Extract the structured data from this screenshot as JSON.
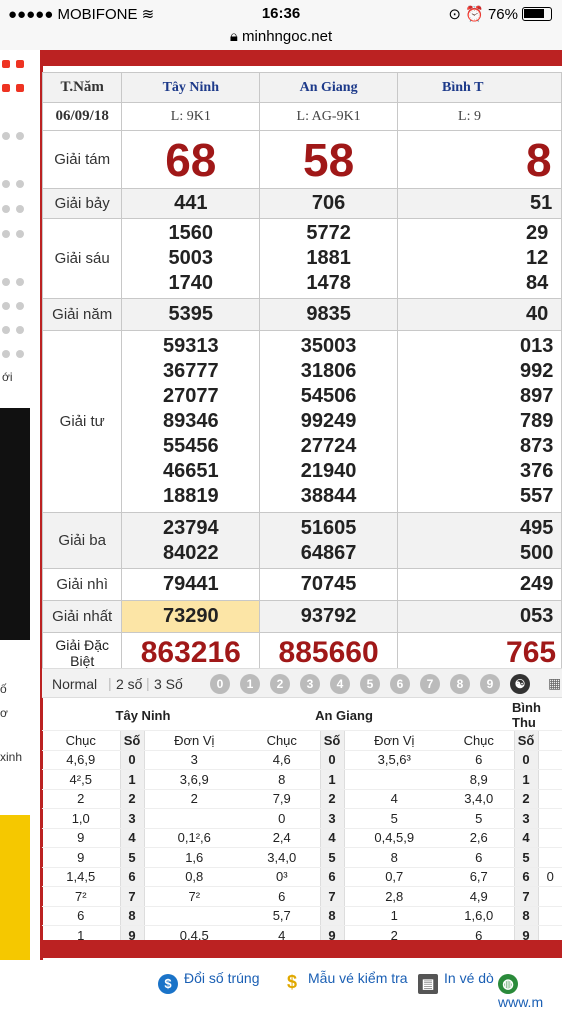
{
  "status": {
    "carrier": "MOBIFONE",
    "time": "16:36",
    "battery": "76%"
  },
  "browser": {
    "url": "minhngoc.net"
  },
  "sidebar": {
    "texts": [
      "ới",
      "ố",
      "ơ",
      "xinh"
    ]
  },
  "results": {
    "label_header": "T.Năm",
    "label_date": "06/09/18",
    "provinces": [
      {
        "name": "Tây Ninh",
        "code": "L: 9K1",
        "g8": "68",
        "g7": "441",
        "g6": [
          "1560",
          "5003",
          "1740"
        ],
        "g5": "5395",
        "g4": [
          "59313",
          "36777",
          "27077",
          "89346",
          "55456",
          "46651",
          "18819"
        ],
        "g3": [
          "23794",
          "84022"
        ],
        "g2": "79441",
        "g1": "73290",
        "gdb": "863216"
      },
      {
        "name": "An Giang",
        "code": "L: AG-9K1",
        "g8": "58",
        "g7": "706",
        "g6": [
          "5772",
          "1881",
          "1478"
        ],
        "g5": "9835",
        "g4": [
          "35003",
          "31806",
          "54506",
          "99249",
          "27724",
          "21940",
          "38844"
        ],
        "g3": [
          "51605",
          "64867"
        ],
        "g2": "70745",
        "g1": "93792",
        "gdb": "885660"
      },
      {
        "name": "Bình T",
        "code": "L: 9",
        "g8": "8",
        "g7": "51",
        "g6": [
          "29",
          "12",
          "84"
        ],
        "g5": "40",
        "g4": [
          "013",
          "992",
          "897",
          "789",
          "873",
          "376",
          "557"
        ],
        "g3": [
          "495",
          "500"
        ],
        "g2": "249",
        "g1": "053",
        "gdb": "765"
      }
    ],
    "labels": {
      "g8": "Giải tám",
      "g7": "Giải bảy",
      "g6": "Giải sáu",
      "g5": "Giải năm",
      "g4": "Giải tư",
      "g3": "Giải ba",
      "g2": "Giải nhì",
      "g1": "Giải nhất",
      "gdb": "Giải Đặc Biệt"
    }
  },
  "filter": {
    "tabs": [
      "Normal",
      "2 số",
      "3 Số"
    ],
    "digits": [
      "0",
      "1",
      "2",
      "3",
      "4",
      "5",
      "6",
      "7",
      "8",
      "9"
    ]
  },
  "loto": {
    "headers": [
      "Tây Ninh",
      "An Giang",
      "Bình Thu"
    ],
    "subheaders": {
      "chuc": "Chục",
      "so": "Số",
      "donvi": "Đơn Vị"
    },
    "rows": [
      {
        "so": "0",
        "tn": [
          "4,6,9",
          "3"
        ],
        "ag": [
          "4,6",
          "3,5,6³"
        ],
        "bt": [
          "6",
          ""
        ]
      },
      {
        "so": "1",
        "tn": [
          "4²,5",
          "3,6,9"
        ],
        "ag": [
          "8",
          ""
        ],
        "bt": [
          "8,9",
          ""
        ]
      },
      {
        "so": "2",
        "tn": [
          "2",
          "2"
        ],
        "ag": [
          "7,9",
          "4"
        ],
        "bt": [
          "3,4,0",
          ""
        ]
      },
      {
        "so": "3",
        "tn": [
          "1,0",
          ""
        ],
        "ag": [
          "0",
          "5"
        ],
        "bt": [
          "5",
          ""
        ]
      },
      {
        "so": "4",
        "tn": [
          "9",
          "0,1²,6"
        ],
        "ag": [
          "2,4",
          "0,4,5,9"
        ],
        "bt": [
          "2,6",
          ""
        ]
      },
      {
        "so": "5",
        "tn": [
          "9",
          "1,6"
        ],
        "ag": [
          "3,4,0",
          "8"
        ],
        "bt": [
          "6",
          ""
        ]
      },
      {
        "so": "6",
        "tn": [
          "1,4,5",
          "0,8"
        ],
        "ag": [
          "0³",
          "0,7"
        ],
        "bt": [
          "6,7",
          "0"
        ]
      },
      {
        "so": "7",
        "tn": [
          "7²",
          "7²"
        ],
        "ag": [
          "6",
          "2,8"
        ],
        "bt": [
          "4,9",
          ""
        ]
      },
      {
        "so": "8",
        "tn": [
          "6",
          ""
        ],
        "ag": [
          "5,7",
          "1"
        ],
        "bt": [
          "1,6,0",
          ""
        ]
      },
      {
        "so": "9",
        "tn": [
          "1",
          "0,4,5"
        ],
        "ag": [
          "4",
          "2"
        ],
        "bt": [
          "6",
          ""
        ]
      }
    ]
  },
  "footer": {
    "link1": "Đổi số trúng",
    "link2": "Mẫu vé kiểm tra",
    "link3": "In vé dò",
    "link4": "www.m"
  },
  "colors": {
    "accent": "#b22222",
    "special": "#a01818",
    "highlight": "#fce5a6",
    "province": "#1d3a8a"
  }
}
